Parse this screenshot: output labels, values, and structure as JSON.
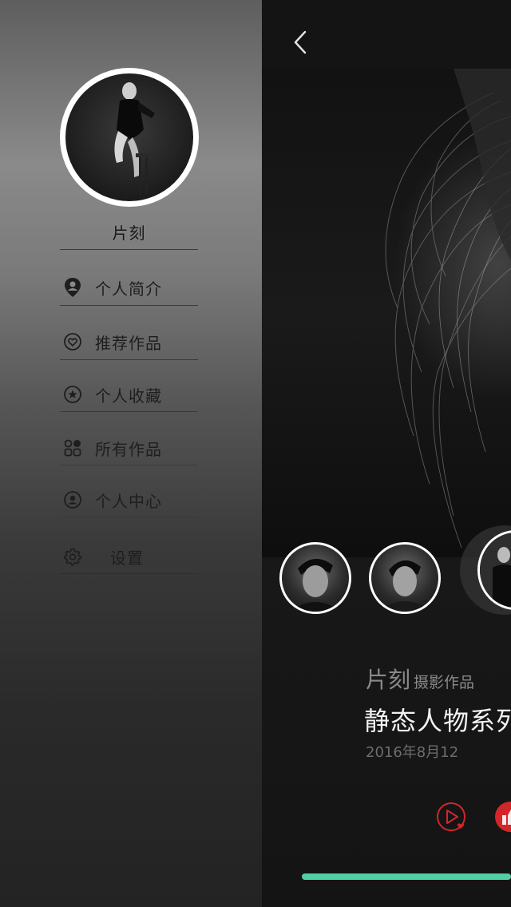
{
  "drawer": {
    "profile_name": "片刻",
    "menu": [
      {
        "label": "个人简介",
        "icon": "profile-pin-icon"
      },
      {
        "label": "推荐作品",
        "icon": "heart-circle-icon"
      },
      {
        "label": "个人收藏",
        "icon": "star-circle-icon"
      },
      {
        "label": "所有作品",
        "icon": "grid-icon"
      },
      {
        "label": "个人中心",
        "icon": "user-circle-icon"
      },
      {
        "label": "设置",
        "icon": "gear-icon"
      }
    ]
  },
  "detail": {
    "author_name": "片刻",
    "author_suffix": "摄影作品",
    "title": "静态人物系列",
    "date": "2016年8月12",
    "accent_color": "#4fcfa5",
    "like_color": "#d3262a"
  }
}
